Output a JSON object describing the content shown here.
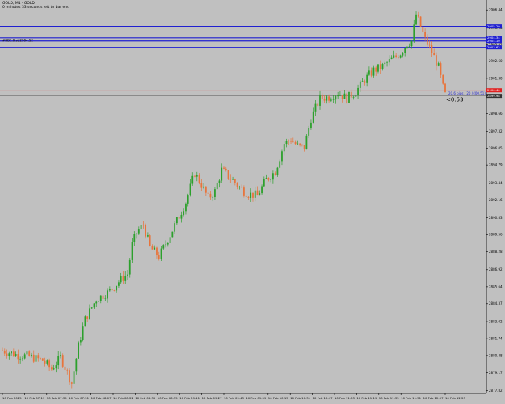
{
  "header": {
    "symbol_line": "GOLD, M1 · GOLD",
    "info_line": "0 minutes 33 seconds left to bar end"
  },
  "colors": {
    "background": "#c0c0c0",
    "bull": "#2ca02c",
    "bear": "#e8743b",
    "hline_blue": "#1f1fd0",
    "hline_red": "#e06060",
    "grid_text": "#000000"
  },
  "chart_data": {
    "type": "candlestick",
    "symbol": "GOLD",
    "timeframe": "M1",
    "ylim": [
      2877.62,
      2907.06
    ],
    "y_ticks": [
      "2906.44",
      "2905.08",
      "2903.82",
      "2902.60",
      "2901.30",
      "2899.92",
      "2898.66",
      "2897.32",
      "2896.05",
      "2894.79",
      "2893.44",
      "2892.16",
      "2890.83",
      "2889.56",
      "2888.28",
      "2886.92",
      "2885.64",
      "2884.37",
      "2883.02",
      "2881.74",
      "2880.48",
      "2879.17",
      "2877.82"
    ],
    "x_ticks": [
      "10 Feb 2025",
      "10 Feb 07:19",
      "10 Feb 07:35",
      "10 Feb 07:51",
      "10 Feb 08:07",
      "10 Feb 08:22",
      "10 Feb 08:39",
      "10 Feb 08:55",
      "10 Feb 09:11",
      "10 Feb 09:27",
      "10 Feb 09:43",
      "10 Feb 09:59",
      "10 Feb 10:15",
      "10 Feb 10:31",
      "10 Feb 10:47",
      "10 Feb 11:03",
      "10 Feb 11:19",
      "10 Feb 11:35",
      "10 Feb 11:51",
      "10 Feb 12:07",
      "10 Feb 12:23"
    ],
    "anchors": [
      {
        "i": 0,
        "v": 2880.85
      },
      {
        "i": 6,
        "v": 2880.55
      },
      {
        "i": 12,
        "v": 2880.4
      },
      {
        "i": 18,
        "v": 2880.1
      },
      {
        "i": 22,
        "v": 2879.45
      },
      {
        "i": 26,
        "v": 2880.35
      },
      {
        "i": 29,
        "v": 2879.2
      },
      {
        "i": 31,
        "v": 2878.4
      },
      {
        "i": 34,
        "v": 2881.2
      },
      {
        "i": 37,
        "v": 2883.2
      },
      {
        "i": 42,
        "v": 2884.7
      },
      {
        "i": 48,
        "v": 2885.3
      },
      {
        "i": 53,
        "v": 2886.2
      },
      {
        "i": 56,
        "v": 2886.6
      },
      {
        "i": 58,
        "v": 2888.8
      },
      {
        "i": 60,
        "v": 2889.7
      },
      {
        "i": 63,
        "v": 2890.3
      },
      {
        "i": 66,
        "v": 2888.6
      },
      {
        "i": 70,
        "v": 2887.9
      },
      {
        "i": 74,
        "v": 2889.2
      },
      {
        "i": 78,
        "v": 2890.6
      },
      {
        "i": 82,
        "v": 2892.0
      },
      {
        "i": 86,
        "v": 2894.2
      },
      {
        "i": 89,
        "v": 2893.3
      },
      {
        "i": 92,
        "v": 2892.3
      },
      {
        "i": 95,
        "v": 2892.8
      },
      {
        "i": 98,
        "v": 2894.4
      },
      {
        "i": 102,
        "v": 2893.8
      },
      {
        "i": 106,
        "v": 2893.1
      },
      {
        "i": 110,
        "v": 2892.6
      },
      {
        "i": 114,
        "v": 2892.5
      },
      {
        "i": 118,
        "v": 2893.7
      },
      {
        "i": 122,
        "v": 2894.3
      },
      {
        "i": 126,
        "v": 2896.4
      },
      {
        "i": 129,
        "v": 2896.7
      },
      {
        "i": 132,
        "v": 2896.2
      },
      {
        "i": 135,
        "v": 2896.1
      },
      {
        "i": 138,
        "v": 2898.3
      },
      {
        "i": 142,
        "v": 2899.8
      },
      {
        "i": 146,
        "v": 2899.9
      },
      {
        "i": 150,
        "v": 2900.2
      },
      {
        "i": 154,
        "v": 2899.8
      },
      {
        "i": 158,
        "v": 2900.3
      },
      {
        "i": 162,
        "v": 2901.2
      },
      {
        "i": 166,
        "v": 2901.9
      },
      {
        "i": 170,
        "v": 2902.2
      },
      {
        "i": 174,
        "v": 2902.7
      },
      {
        "i": 178,
        "v": 2903.2
      },
      {
        "i": 181,
        "v": 2903.9
      },
      {
        "i": 183,
        "v": 2904.1
      },
      {
        "i": 185,
        "v": 2906.1
      },
      {
        "i": 187,
        "v": 2905.2
      },
      {
        "i": 189,
        "v": 2904.2
      },
      {
        "i": 191,
        "v": 2903.6
      },
      {
        "i": 193,
        "v": 2902.9
      },
      {
        "i": 195,
        "v": 2902.1
      },
      {
        "i": 197,
        "v": 2900.6
      },
      {
        "i": 198,
        "v": 2900.05
      }
    ],
    "count": 199,
    "current_price": 2899.98,
    "current_price_label": "2899.98",
    "blue_lines": [
      {
        "value": 2905.2,
        "label": "2905.20"
      },
      {
        "value": 2904.34,
        "label": "2904.34"
      },
      {
        "value": 2904.1,
        "label": "2904.10"
      },
      {
        "value": 2903.62,
        "label": "2903.62"
      }
    ],
    "red_line": {
      "value": 2900.4,
      "label": "2900.40"
    },
    "left_annotation": "#BB1.0 st 2904.52",
    "right_annotation": "20.6 pips / 20 / (00.51)",
    "countdown": "<0:53"
  }
}
